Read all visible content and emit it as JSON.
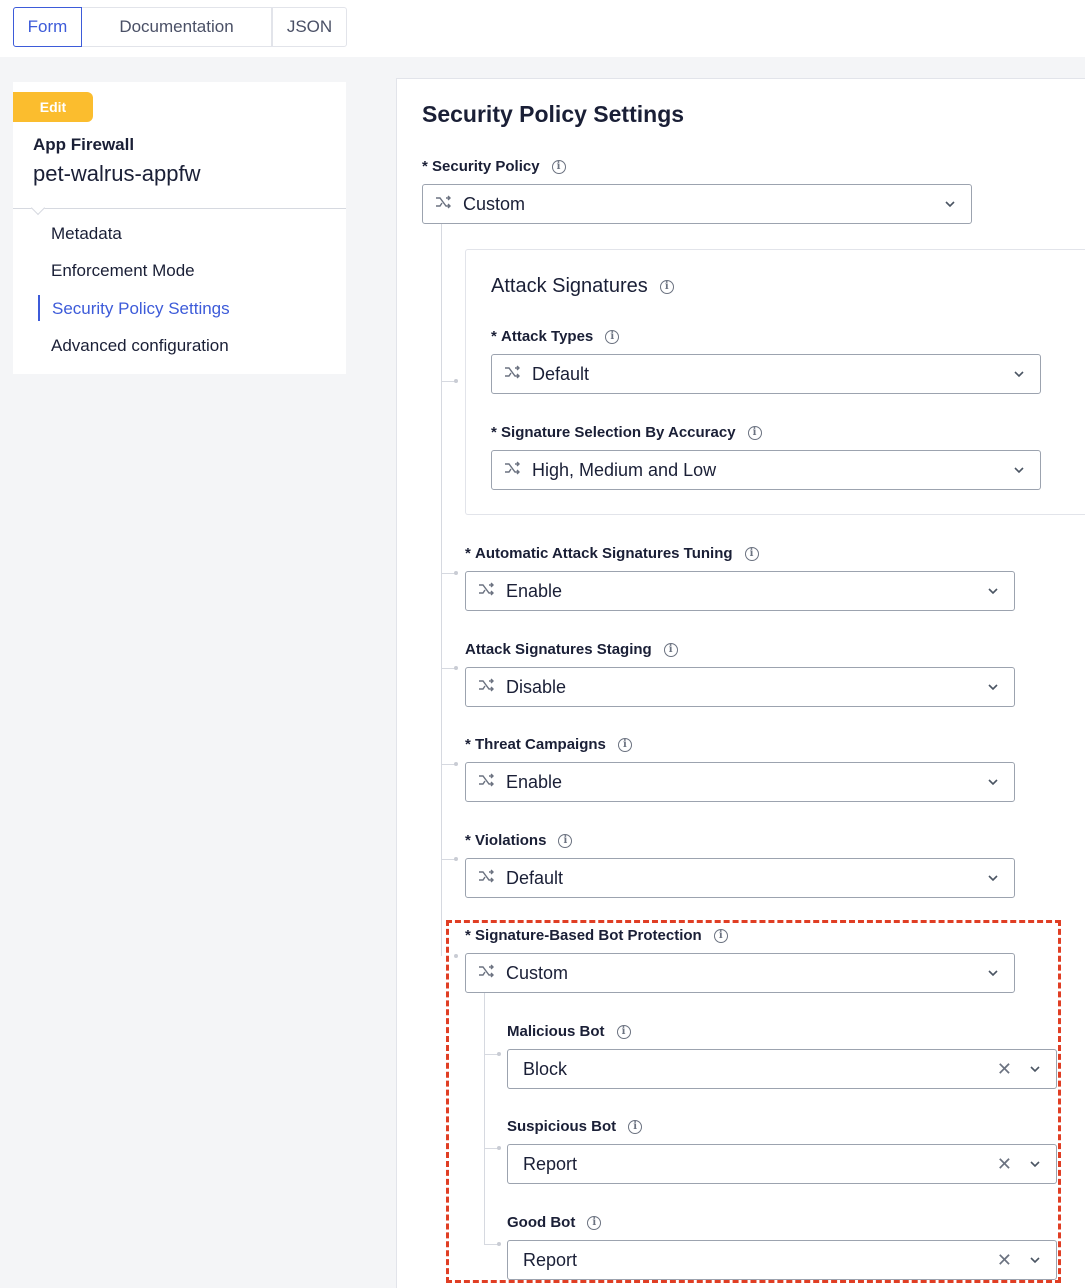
{
  "tabs": [
    "Form",
    "Documentation",
    "JSON"
  ],
  "sidebar": {
    "badge": "Edit",
    "app_type": "App Firewall",
    "app_name": "pet-walrus-appfw",
    "items": [
      "Metadata",
      "Enforcement Mode",
      "Security Policy Settings",
      "Advanced configuration"
    ],
    "active_item": "Security Policy Settings"
  },
  "main": {
    "title": "Security Policy Settings",
    "security_policy": {
      "label": "Security Policy",
      "value": "Custom"
    },
    "attack_signatures": {
      "title": "Attack Signatures",
      "attack_types": {
        "label": "Attack Types",
        "value": "Default"
      },
      "accuracy": {
        "label": "Signature Selection By Accuracy",
        "value": "High, Medium and Low"
      }
    },
    "auto_tuning": {
      "label": "Automatic Attack Signatures Tuning",
      "value": "Enable"
    },
    "staging": {
      "label": "Attack Signatures Staging",
      "value": "Disable"
    },
    "threat_campaigns": {
      "label": "Threat Campaigns",
      "value": "Enable"
    },
    "violations": {
      "label": "Violations",
      "value": "Default"
    },
    "bot_protection": {
      "label": "Signature-Based Bot Protection",
      "value": "Custom",
      "malicious": {
        "label": "Malicious Bot",
        "value": "Block"
      },
      "suspicious": {
        "label": "Suspicious Bot",
        "value": "Report"
      },
      "good": {
        "label": "Good Bot",
        "value": "Report"
      }
    }
  },
  "required_marker": "*",
  "info_glyph": "i",
  "clear_glyph": "✕",
  "colors": {
    "accent": "#3d5bd9",
    "badge": "#fbbd2e",
    "highlight": "#e03e24"
  }
}
